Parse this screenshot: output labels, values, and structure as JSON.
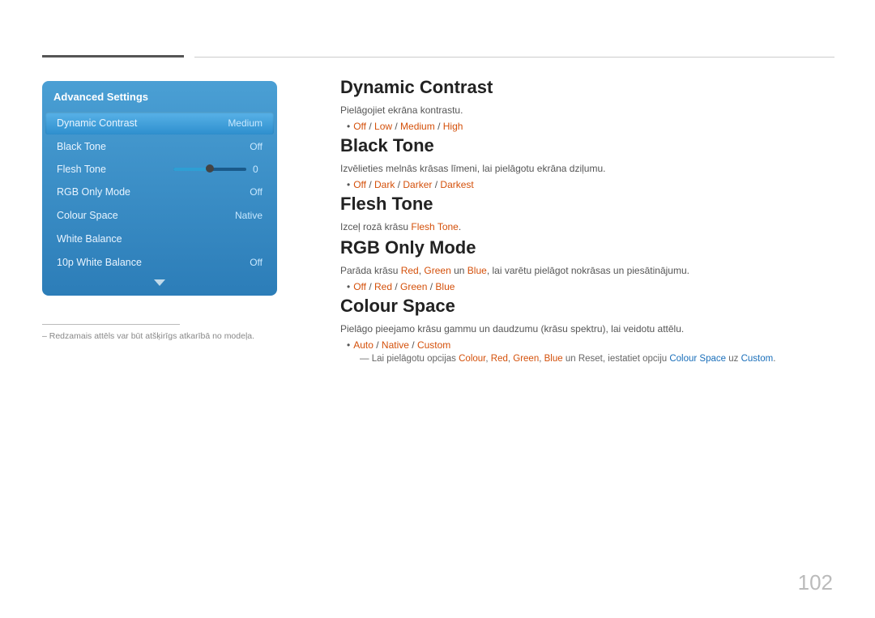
{
  "top_lines": {
    "present": true
  },
  "left_panel": {
    "title": "Advanced Settings",
    "items": [
      {
        "label": "Dynamic Contrast",
        "value": "Medium",
        "active": true
      },
      {
        "label": "Black Tone",
        "value": "Off",
        "active": false
      },
      {
        "label": "Flesh Tone",
        "value": "0",
        "type": "slider",
        "active": false
      },
      {
        "label": "RGB Only Mode",
        "value": "Off",
        "active": false
      },
      {
        "label": "Colour Space",
        "value": "Native",
        "active": false
      },
      {
        "label": "White Balance",
        "value": "",
        "active": false
      },
      {
        "label": "10p White Balance",
        "value": "Off",
        "active": false
      }
    ]
  },
  "panel_note": "– Redzamais attēls var būt atšķirīgs atkarībā no modeļa.",
  "sections": [
    {
      "id": "dynamic-contrast",
      "title": "Dynamic Contrast",
      "desc": "Pielāgojiet ekrāna kontrastu.",
      "bullets": [
        {
          "text_parts": [
            {
              "text": "Off",
              "style": "orange"
            },
            {
              "text": " / ",
              "style": "normal"
            },
            {
              "text": "Low",
              "style": "orange"
            },
            {
              "text": " / ",
              "style": "normal"
            },
            {
              "text": "Medium",
              "style": "orange"
            },
            {
              "text": " / ",
              "style": "normal"
            },
            {
              "text": "High",
              "style": "orange"
            }
          ]
        }
      ]
    },
    {
      "id": "black-tone",
      "title": "Black Tone",
      "desc": "Izvēlieties melnās krāsas līmeni, lai pielāgotu ekrāna dziļumu.",
      "bullets": [
        {
          "text_parts": [
            {
              "text": "Off",
              "style": "orange"
            },
            {
              "text": " / ",
              "style": "normal"
            },
            {
              "text": "Dark",
              "style": "orange"
            },
            {
              "text": " / ",
              "style": "normal"
            },
            {
              "text": "Darker",
              "style": "orange"
            },
            {
              "text": " / ",
              "style": "normal"
            },
            {
              "text": "Darkest",
              "style": "orange"
            }
          ]
        }
      ]
    },
    {
      "id": "flesh-tone",
      "title": "Flesh Tone",
      "desc": "Izceļ rozā krāsu",
      "desc2": "Flesh Tone",
      "desc_suffix": "."
    },
    {
      "id": "rgb-only-mode",
      "title": "RGB Only Mode",
      "desc": "Parāda krāsu",
      "desc_red": "Red",
      "desc_sep1": ", ",
      "desc_green": "Green",
      "desc_sep2": " un ",
      "desc_blue": "Blue",
      "desc_suffix": ", lai varētu pielāgot nokrāsas un piesātinājumu.",
      "bullets": [
        {
          "text_parts": [
            {
              "text": "Off",
              "style": "orange"
            },
            {
              "text": " / ",
              "style": "normal"
            },
            {
              "text": "Red",
              "style": "orange"
            },
            {
              "text": " / ",
              "style": "normal"
            },
            {
              "text": "Green",
              "style": "orange"
            },
            {
              "text": " / ",
              "style": "normal"
            },
            {
              "text": "Blue",
              "style": "orange"
            }
          ]
        }
      ]
    },
    {
      "id": "colour-space",
      "title": "Colour Space",
      "desc": "Pielāgo pieejamo krāsu gammu un daudzumu (krāsu spektru), lai veidotu attēlu.",
      "bullets": [
        {
          "text_parts": [
            {
              "text": "Auto",
              "style": "orange"
            },
            {
              "text": " / ",
              "style": "normal"
            },
            {
              "text": "Native",
              "style": "orange"
            },
            {
              "text": " / ",
              "style": "normal"
            },
            {
              "text": "Custom",
              "style": "orange"
            }
          ]
        }
      ],
      "sub_note_parts": [
        {
          "text": "Lai pielāgotu opcijas ",
          "style": "normal"
        },
        {
          "text": "Colour",
          "style": "orange"
        },
        {
          "text": ", ",
          "style": "normal"
        },
        {
          "text": "Red",
          "style": "orange"
        },
        {
          "text": ", ",
          "style": "normal"
        },
        {
          "text": "Green",
          "style": "orange"
        },
        {
          "text": ", ",
          "style": "normal"
        },
        {
          "text": "Blue",
          "style": "orange"
        },
        {
          "text": " un ",
          "style": "normal"
        },
        {
          "text": "Reset",
          "style": "normal"
        },
        {
          "text": ", iestatiet opciju ",
          "style": "normal"
        },
        {
          "text": "Colour Space",
          "style": "blue"
        },
        {
          "text": " uz ",
          "style": "normal"
        },
        {
          "text": "Custom",
          "style": "blue"
        },
        {
          "text": ".",
          "style": "normal"
        }
      ]
    }
  ],
  "page_number": "102"
}
